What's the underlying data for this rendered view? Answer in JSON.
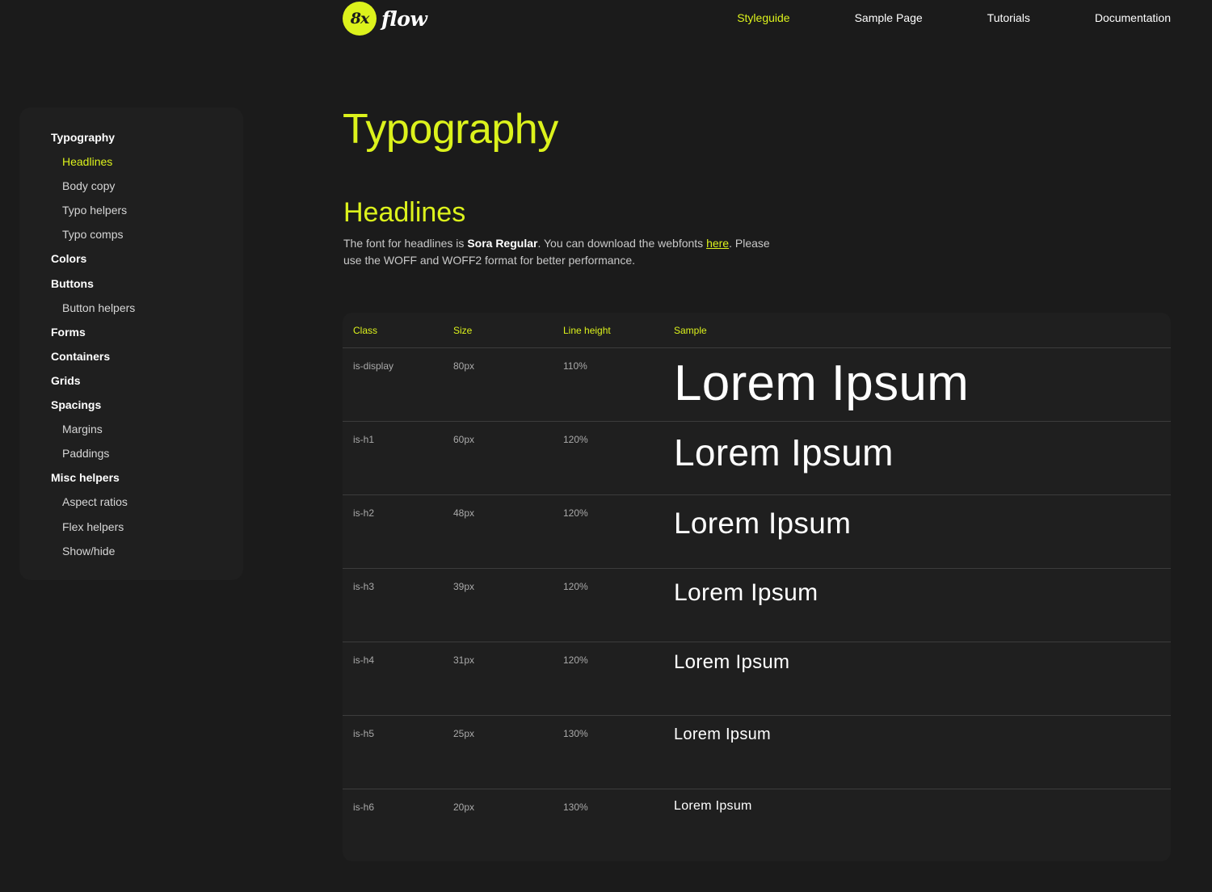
{
  "header": {
    "logo_mark": "8x",
    "logo_word": "flow",
    "nav": [
      {
        "label": "Styleguide",
        "active": true
      },
      {
        "label": "Sample Page",
        "active": false
      },
      {
        "label": "Tutorials",
        "active": false
      },
      {
        "label": "Documentation",
        "active": false
      }
    ]
  },
  "sidebar": {
    "items": [
      {
        "label": "Typography",
        "level": "section"
      },
      {
        "label": "Headlines",
        "level": "sub",
        "active": true
      },
      {
        "label": "Body copy",
        "level": "sub"
      },
      {
        "label": "Typo helpers",
        "level": "sub"
      },
      {
        "label": "Typo comps",
        "level": "sub"
      },
      {
        "label": "Colors",
        "level": "section"
      },
      {
        "label": "Buttons",
        "level": "section"
      },
      {
        "label": "Button helpers",
        "level": "sub"
      },
      {
        "label": "Forms",
        "level": "section"
      },
      {
        "label": "Containers",
        "level": "section"
      },
      {
        "label": "Grids",
        "level": "section"
      },
      {
        "label": "Spacings",
        "level": "section"
      },
      {
        "label": "Margins",
        "level": "sub"
      },
      {
        "label": "Paddings",
        "level": "sub"
      },
      {
        "label": "Misc helpers",
        "level": "section"
      },
      {
        "label": "Aspect ratios",
        "level": "sub"
      },
      {
        "label": "Flex helpers",
        "level": "sub"
      },
      {
        "label": "Show/hide",
        "level": "sub"
      }
    ]
  },
  "main": {
    "page_title": "Typography",
    "section_title": "Headlines",
    "intro": {
      "before": "The font for headlines is ",
      "font_name": "Sora Regular",
      "middle": ". You can download the webfonts ",
      "link_label": "here",
      "after": ". Please use the WOFF and WOFF2 format for better performance."
    },
    "table": {
      "headers": [
        "Class",
        "Size",
        "Line height",
        "Sample"
      ],
      "rows": [
        {
          "class": "is-display",
          "size": "80px",
          "line_height": "110%",
          "sample": "Lorem Ipsum"
        },
        {
          "class": "is-h1",
          "size": "60px",
          "line_height": "120%",
          "sample": "Lorem Ipsum"
        },
        {
          "class": "is-h2",
          "size": "48px",
          "line_height": "120%",
          "sample": "Lorem Ipsum"
        },
        {
          "class": "is-h3",
          "size": "39px",
          "line_height": "120%",
          "sample": "Lorem Ipsum"
        },
        {
          "class": "is-h4",
          "size": "31px",
          "line_height": "120%",
          "sample": "Lorem Ipsum"
        },
        {
          "class": "is-h5",
          "size": "25px",
          "line_height": "130%",
          "sample": "Lorem Ipsum"
        },
        {
          "class": "is-h6",
          "size": "20px",
          "line_height": "130%",
          "sample": "Lorem Ipsum"
        }
      ]
    }
  },
  "colors": {
    "accent": "#dcf21c",
    "background": "#1b1b1b",
    "panel": "#1f1f1f"
  }
}
